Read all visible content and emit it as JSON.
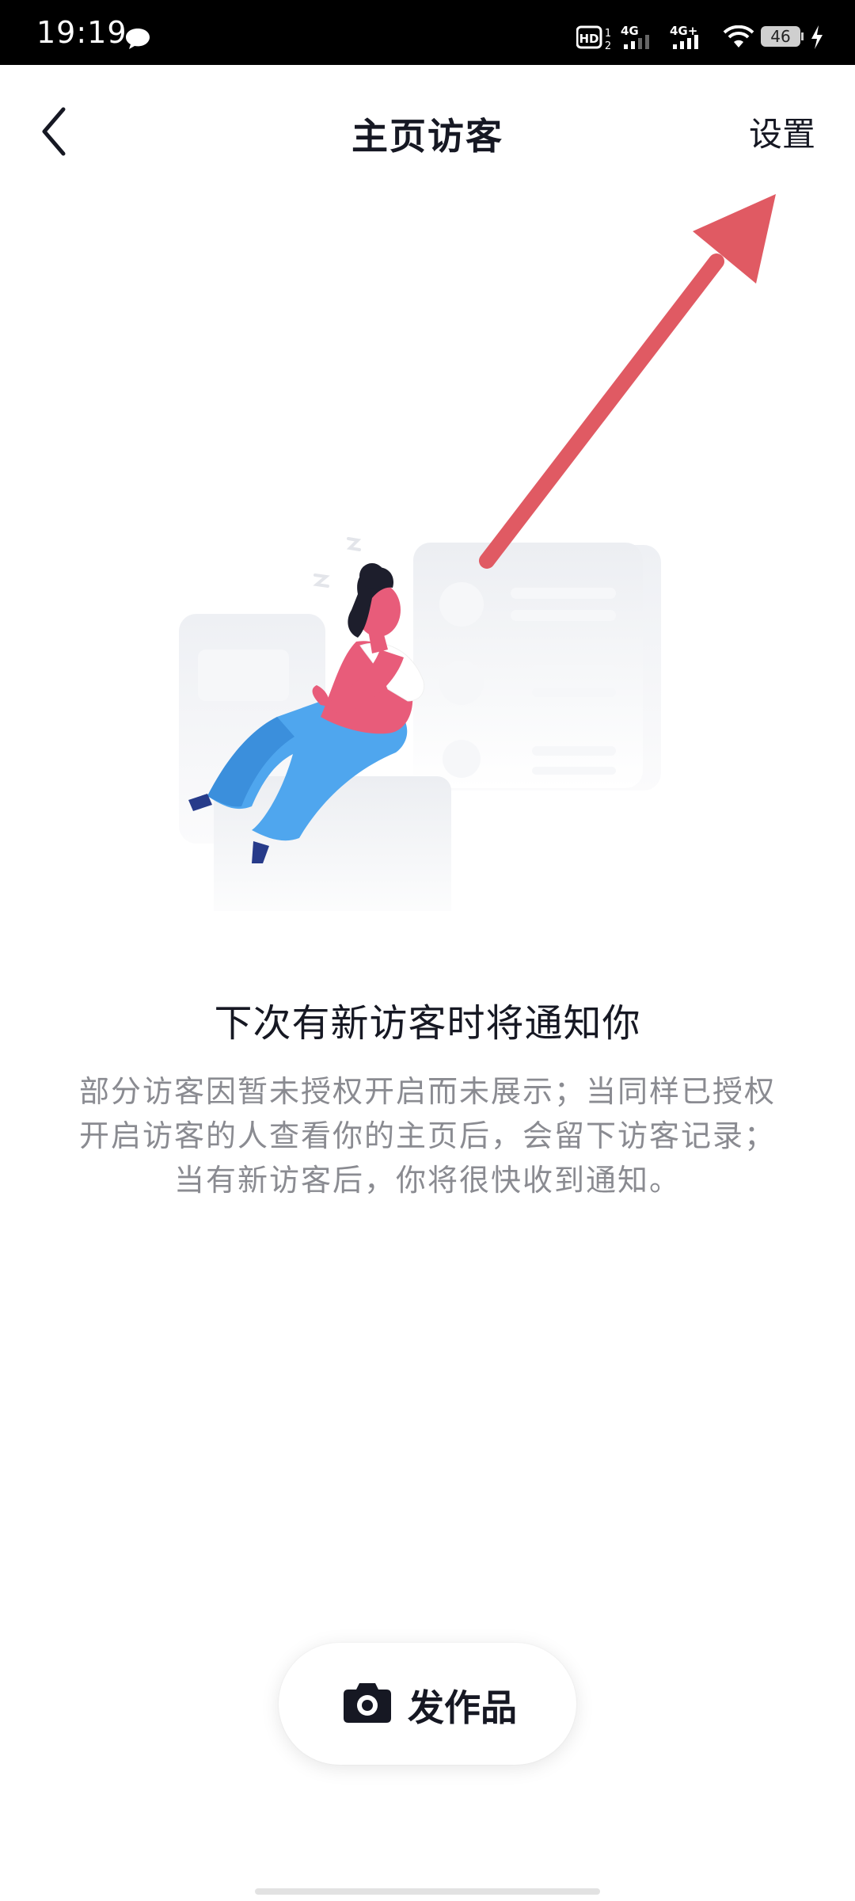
{
  "status_bar": {
    "time": "19:19",
    "hd_label": "HD",
    "network_1": "4G",
    "network_2": "4G+",
    "battery_level": "46",
    "icons": [
      "chat-bubble-icon",
      "hd-voice-icon",
      "signal-icon",
      "signal-icon",
      "wifi-icon",
      "battery-icon",
      "charging-icon"
    ]
  },
  "header": {
    "title": "主页访客",
    "settings_label": "设置",
    "back_icon": "chevron-left-icon"
  },
  "empty_state": {
    "title": "下次有新访客时将通知你",
    "description": "部分访客因暂未授权开启而未展示；当同样已授权开启访客的人查看你的主页后，会留下访客记录；当有新访客后，你将很快收到通知。"
  },
  "post_button": {
    "label": "发作品",
    "icon": "camera-icon"
  },
  "colors": {
    "arrow": "#e05a63",
    "figure_pink": "#e85c7a",
    "figure_blue": "#4fa6ee",
    "card_gray": "#eef0f4"
  }
}
